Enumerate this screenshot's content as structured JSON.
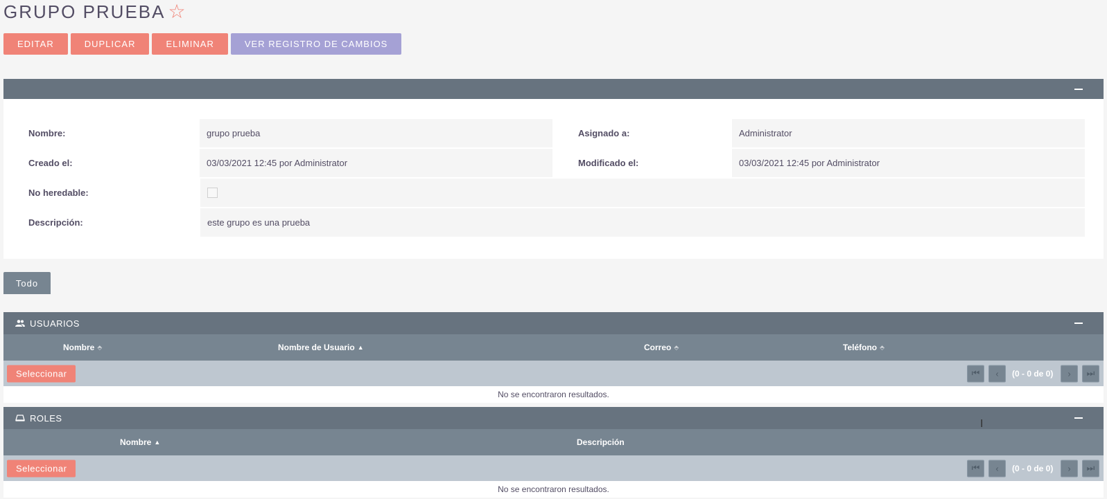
{
  "page": {
    "title": "GRUPO PRUEBA"
  },
  "actions": {
    "edit": "EDITAR",
    "duplicate": "DUPLICAR",
    "delete": "ELIMINAR",
    "changelog": "VER REGISTRO DE CAMBIOS"
  },
  "detail": {
    "name_label": "Nombre:",
    "name_value": "grupo prueba",
    "assigned_label": "Asignado a:",
    "assigned_value": "Administrator",
    "created_label": "Creado el:",
    "created_value": "03/03/2021 12:45 por Administrator",
    "modified_label": "Modificado el:",
    "modified_value": "03/03/2021 12:45 por Administrator",
    "noninheritable_label": "No heredable:",
    "noninheritable_checked": false,
    "description_label": "Descripción:",
    "description_value": "este grupo es una prueba"
  },
  "tabs": {
    "all": "Todo"
  },
  "users": {
    "title": "USUARIOS",
    "columns": [
      "Nombre",
      "Nombre de Usuario",
      "Correo",
      "Teléfono"
    ],
    "select_label": "Seleccionar",
    "pager": "(0 - 0 de 0)",
    "empty": "No se encontraron resultados."
  },
  "roles": {
    "title": "ROLES",
    "columns": [
      "Nombre",
      "Descripción"
    ],
    "select_label": "Seleccionar",
    "pager": "(0 - 0 de 0)",
    "empty": "No se encontraron resultados."
  },
  "icons": {
    "favorite": "star-outline-icon",
    "users": "users-icon",
    "roles": "roles-icon",
    "collapse": "minus-icon"
  },
  "colors": {
    "accent_red": "#f08377",
    "accent_purple": "#a5a1d5",
    "header_dark": "#67737f",
    "header_mid": "#778591",
    "pager_bg": "#bec7d0"
  }
}
